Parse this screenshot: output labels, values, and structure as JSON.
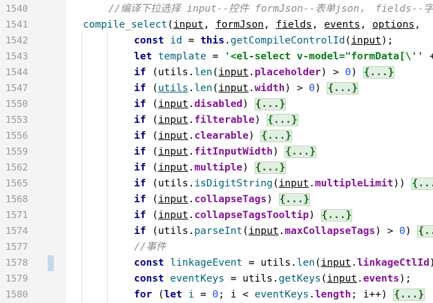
{
  "editor": {
    "lines": [
      {
        "num": "1540",
        "indent": 1,
        "tokens": [
          {
            "t": "cmt",
            "v": "//编译下拉选择 input--控件 formJson--表单json， fields--字段"
          }
        ]
      },
      {
        "num": "1541",
        "indent": 0,
        "marker": false,
        "tokens": [
          {
            "t": "fn",
            "v": "compile_select"
          },
          {
            "t": "p",
            "v": "("
          },
          {
            "t": "pm",
            "v": "input"
          },
          {
            "t": "p",
            "v": ", "
          },
          {
            "t": "pm",
            "v": "formJson"
          },
          {
            "t": "p",
            "v": ", "
          },
          {
            "t": "pm",
            "v": "fields"
          },
          {
            "t": "p",
            "v": ", "
          },
          {
            "t": "pm",
            "v": "events"
          },
          {
            "t": "p",
            "v": ", "
          },
          {
            "t": "pm",
            "v": "options"
          },
          {
            "t": "p",
            "v": ", "
          }
        ]
      },
      {
        "num": "1542",
        "indent": 2,
        "tokens": [
          {
            "t": "kw",
            "v": "const "
          },
          {
            "t": "fn",
            "v": "id"
          },
          {
            "t": "p",
            "v": " = "
          },
          {
            "t": "kw",
            "v": "this"
          },
          {
            "t": "p",
            "v": "."
          },
          {
            "t": "fn",
            "v": "getCompileControlId"
          },
          {
            "t": "p",
            "v": "("
          },
          {
            "t": "pm",
            "v": "input"
          },
          {
            "t": "p",
            "v": ");"
          }
        ]
      },
      {
        "num": "1543",
        "indent": 2,
        "tokens": [
          {
            "t": "kw",
            "v": "let "
          },
          {
            "t": "fn",
            "v": "template"
          },
          {
            "t": "p",
            "v": " = "
          },
          {
            "t": "str",
            "v": "'<el-select v-model=\"formData[\\''"
          },
          {
            "t": "p",
            "v": " + i"
          }
        ]
      },
      {
        "num": "1544",
        "indent": 2,
        "tokens": [
          {
            "t": "kw",
            "v": "if "
          },
          {
            "t": "p",
            "v": "(utils."
          },
          {
            "t": "fn",
            "v": "len"
          },
          {
            "t": "p",
            "v": "("
          },
          {
            "t": "pm",
            "v": "input"
          },
          {
            "t": "p",
            "v": "."
          },
          {
            "t": "prop",
            "v": "placeholder"
          },
          {
            "t": "p",
            "v": ") > "
          },
          {
            "t": "num-lit",
            "v": "0"
          },
          {
            "t": "p",
            "v": ") "
          },
          {
            "t": "fold",
            "v": "{...}"
          }
        ]
      },
      {
        "num": "1547",
        "indent": 2,
        "tokens": [
          {
            "t": "kw",
            "v": "if "
          },
          {
            "t": "p",
            "v": "("
          },
          {
            "t": "pmfn",
            "v": "utils"
          },
          {
            "t": "p",
            "v": "."
          },
          {
            "t": "fn",
            "v": "len"
          },
          {
            "t": "p",
            "v": "("
          },
          {
            "t": "pm",
            "v": "input"
          },
          {
            "t": "p",
            "v": "."
          },
          {
            "t": "prop",
            "v": "width"
          },
          {
            "t": "p",
            "v": ") > "
          },
          {
            "t": "num-lit",
            "v": "0"
          },
          {
            "t": "p",
            "v": ") "
          },
          {
            "t": "fold",
            "v": "{...}"
          }
        ]
      },
      {
        "num": "1550",
        "indent": 2,
        "tokens": [
          {
            "t": "kw",
            "v": "if "
          },
          {
            "t": "p",
            "v": "("
          },
          {
            "t": "pm",
            "v": "input"
          },
          {
            "t": "p",
            "v": "."
          },
          {
            "t": "prop",
            "v": "disabled"
          },
          {
            "t": "p",
            "v": ") "
          },
          {
            "t": "fold",
            "v": "{...}"
          }
        ]
      },
      {
        "num": "1553",
        "indent": 2,
        "tokens": [
          {
            "t": "kw",
            "v": "if "
          },
          {
            "t": "p",
            "v": "("
          },
          {
            "t": "pm",
            "v": "input"
          },
          {
            "t": "p",
            "v": "."
          },
          {
            "t": "prop",
            "v": "filterable"
          },
          {
            "t": "p",
            "v": ") "
          },
          {
            "t": "fold",
            "v": "{...}"
          }
        ]
      },
      {
        "num": "1556",
        "indent": 2,
        "tokens": [
          {
            "t": "kw",
            "v": "if "
          },
          {
            "t": "p",
            "v": "("
          },
          {
            "t": "pm",
            "v": "input"
          },
          {
            "t": "p",
            "v": "."
          },
          {
            "t": "prop",
            "v": "clearable"
          },
          {
            "t": "p",
            "v": ") "
          },
          {
            "t": "fold",
            "v": "{...}"
          }
        ]
      },
      {
        "num": "1559",
        "indent": 2,
        "tokens": [
          {
            "t": "kw",
            "v": "if "
          },
          {
            "t": "p",
            "v": "("
          },
          {
            "t": "pm",
            "v": "input"
          },
          {
            "t": "p",
            "v": "."
          },
          {
            "t": "prop",
            "v": "fitInputWidth"
          },
          {
            "t": "p",
            "v": ") "
          },
          {
            "t": "fold",
            "v": "{...}"
          }
        ]
      },
      {
        "num": "1562",
        "indent": 2,
        "tokens": [
          {
            "t": "kw",
            "v": "if "
          },
          {
            "t": "p",
            "v": "("
          },
          {
            "t": "pm",
            "v": "input"
          },
          {
            "t": "p",
            "v": "."
          },
          {
            "t": "prop",
            "v": "multiple"
          },
          {
            "t": "p",
            "v": ") "
          },
          {
            "t": "fold",
            "v": "{...}"
          }
        ]
      },
      {
        "num": "1565",
        "indent": 2,
        "tokens": [
          {
            "t": "kw",
            "v": "if "
          },
          {
            "t": "p",
            "v": "(utils."
          },
          {
            "t": "fn",
            "v": "isDigitString"
          },
          {
            "t": "p",
            "v": "("
          },
          {
            "t": "pm",
            "v": "input"
          },
          {
            "t": "p",
            "v": "."
          },
          {
            "t": "prop",
            "v": "multipleLimit"
          },
          {
            "t": "p",
            "v": ")) "
          },
          {
            "t": "fold",
            "v": "{...}"
          }
        ]
      },
      {
        "num": "1568",
        "indent": 2,
        "tokens": [
          {
            "t": "kw",
            "v": "if "
          },
          {
            "t": "p",
            "v": "("
          },
          {
            "t": "pm",
            "v": "input"
          },
          {
            "t": "p",
            "v": "."
          },
          {
            "t": "prop",
            "v": "collapseTags"
          },
          {
            "t": "p",
            "v": ") "
          },
          {
            "t": "fold",
            "v": "{...}"
          }
        ]
      },
      {
        "num": "1571",
        "indent": 2,
        "tokens": [
          {
            "t": "kw",
            "v": "if "
          },
          {
            "t": "p",
            "v": "("
          },
          {
            "t": "pm",
            "v": "input"
          },
          {
            "t": "p",
            "v": "."
          },
          {
            "t": "prop",
            "v": "collapseTagsTooltip"
          },
          {
            "t": "p",
            "v": ") "
          },
          {
            "t": "fold",
            "v": "{...}"
          }
        ]
      },
      {
        "num": "1574",
        "indent": 2,
        "tokens": [
          {
            "t": "kw",
            "v": "if "
          },
          {
            "t": "p",
            "v": "(utils."
          },
          {
            "t": "fn",
            "v": "parseInt"
          },
          {
            "t": "p",
            "v": "("
          },
          {
            "t": "pm",
            "v": "input"
          },
          {
            "t": "p",
            "v": "."
          },
          {
            "t": "prop",
            "v": "maxCollapseTags"
          },
          {
            "t": "p",
            "v": ") > "
          },
          {
            "t": "num-lit",
            "v": "0"
          },
          {
            "t": "p",
            "v": ") "
          },
          {
            "t": "fold",
            "v": "{...}"
          }
        ]
      },
      {
        "num": "1577",
        "indent": 2,
        "tokens": [
          {
            "t": "cmt",
            "v": "//事件"
          }
        ]
      },
      {
        "num": "1578",
        "indent": 2,
        "marker": true,
        "tokens": [
          {
            "t": "kw",
            "v": "const "
          },
          {
            "t": "fn",
            "v": "linkageEvent"
          },
          {
            "t": "p",
            "v": " = utils."
          },
          {
            "t": "fn",
            "v": "len"
          },
          {
            "t": "p",
            "v": "("
          },
          {
            "t": "pm",
            "v": "input"
          },
          {
            "t": "p",
            "v": "."
          },
          {
            "t": "prop",
            "v": "linkageCtlId"
          },
          {
            "t": "p",
            "v": ") =="
          }
        ]
      },
      {
        "num": "1579",
        "indent": 2,
        "tokens": [
          {
            "t": "kw",
            "v": "const "
          },
          {
            "t": "fn",
            "v": "eventKeys"
          },
          {
            "t": "p",
            "v": " = utils."
          },
          {
            "t": "fn",
            "v": "getKeys"
          },
          {
            "t": "p",
            "v": "("
          },
          {
            "t": "pm",
            "v": "input"
          },
          {
            "t": "p",
            "v": "."
          },
          {
            "t": "prop",
            "v": "events"
          },
          {
            "t": "p",
            "v": ");"
          }
        ]
      },
      {
        "num": "1580",
        "indent": 2,
        "tokens": [
          {
            "t": "kw",
            "v": "for "
          },
          {
            "t": "p",
            "v": "("
          },
          {
            "t": "kw",
            "v": "let "
          },
          {
            "t": "fn",
            "v": "i"
          },
          {
            "t": "p",
            "v": " = "
          },
          {
            "t": "num-lit",
            "v": "0"
          },
          {
            "t": "p",
            "v": "; i < "
          },
          {
            "t": "fn",
            "v": "eventKeys"
          },
          {
            "t": "p",
            "v": "."
          },
          {
            "t": "prop",
            "v": "length"
          },
          {
            "t": "p",
            "v": "; i++) "
          },
          {
            "t": "fold",
            "v": "{...}"
          }
        ]
      }
    ]
  },
  "colors": {
    "keyword": "#000080",
    "function": "#00627a",
    "property": "#871094",
    "string": "#067d17",
    "number": "#1750eb",
    "comment": "#8c8c8c",
    "fold": "#1d6b1d"
  }
}
